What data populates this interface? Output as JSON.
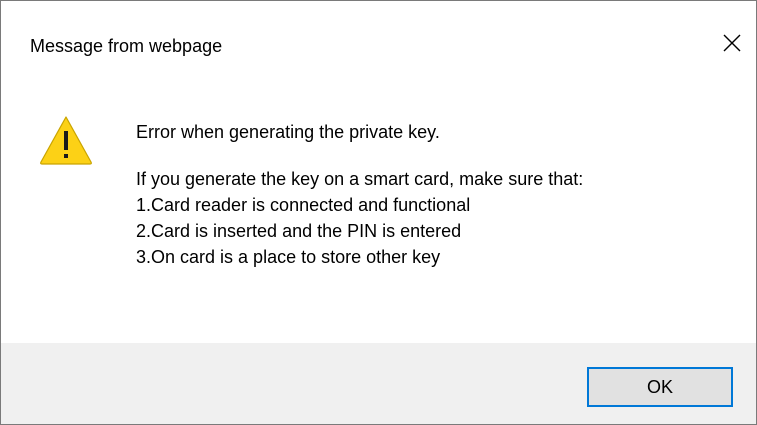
{
  "dialog": {
    "title": "Message from webpage",
    "close_icon": "close-icon",
    "warning_icon": "warning-icon",
    "message": {
      "heading": "Error when generating the private key.",
      "intro": "If you generate the key on a smart card, make sure that:",
      "items": [
        "1.Card reader is connected and functional",
        "2.Card is inserted and the PIN is entered",
        "3.On card is a place to store other key"
      ]
    },
    "ok_label": "OK"
  },
  "colors": {
    "accent": "#0078d7",
    "footer_bg": "#f0f0f0",
    "button_bg": "#e1e1e1",
    "warning_yellow": "#fcd116"
  }
}
